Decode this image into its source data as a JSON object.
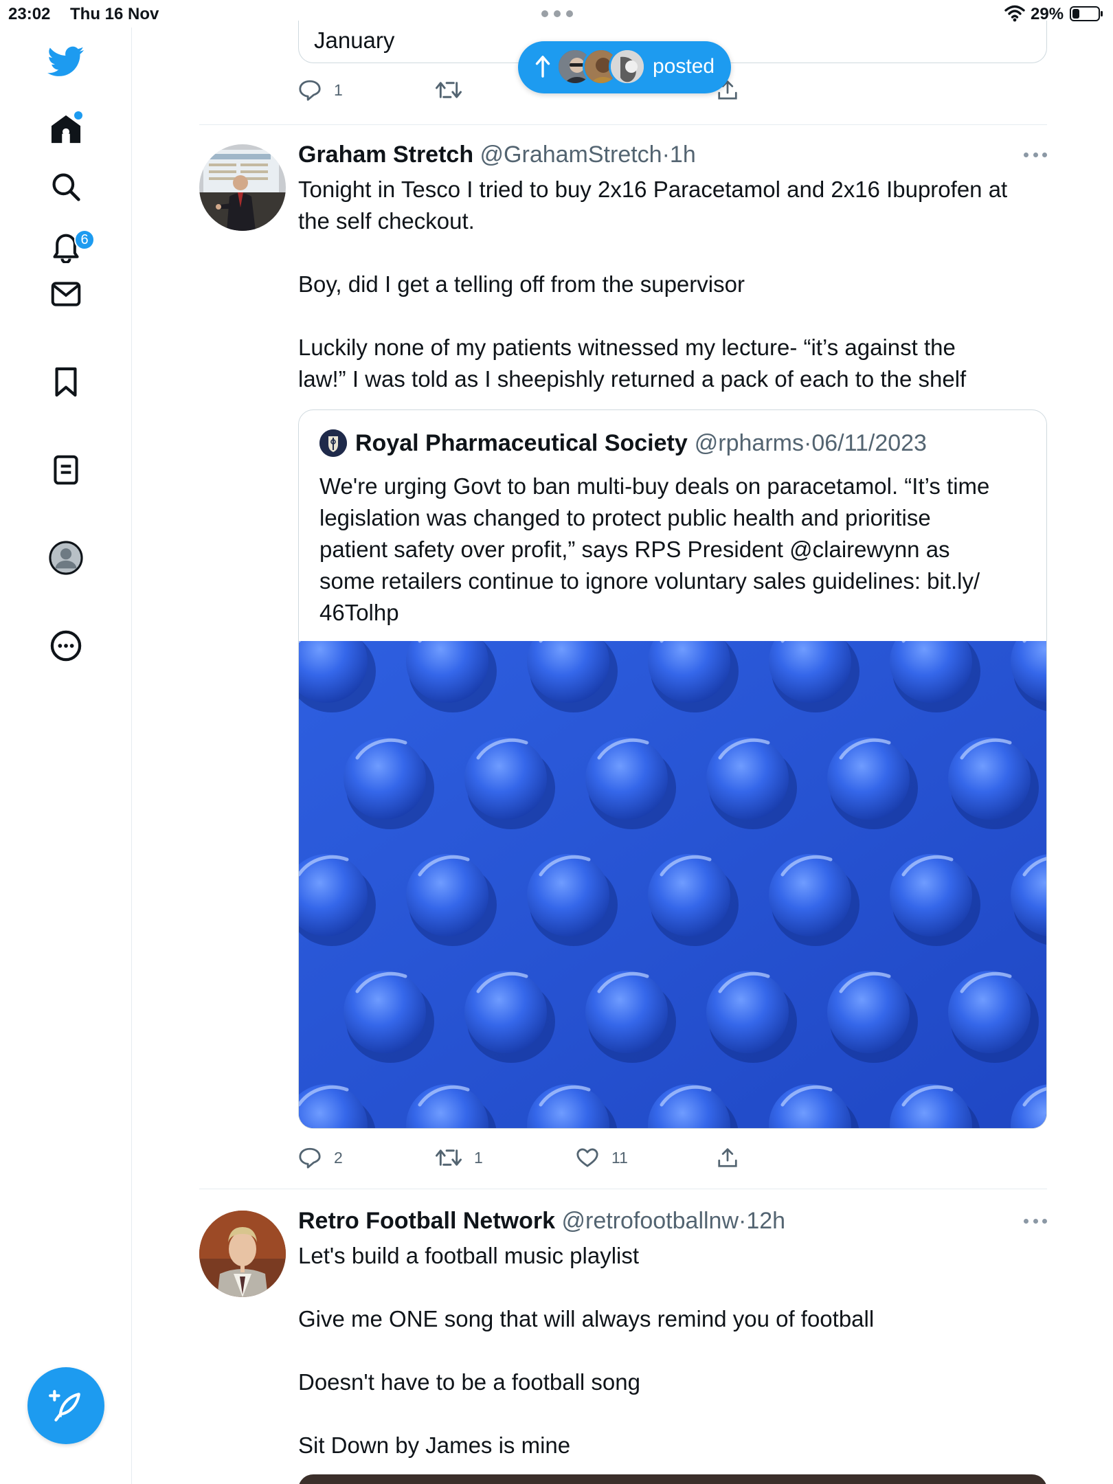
{
  "status_bar": {
    "time": "23:02",
    "date": "Thu 16 Nov",
    "battery_percent": "29%",
    "battery_level": 0.29
  },
  "sidebar": {
    "icons": [
      "twitter-bird-icon",
      "home-icon",
      "search-icon",
      "notifications-icon",
      "messages-icon",
      "bookmarks-icon",
      "lists-icon",
      "profile-icon",
      "more-icon"
    ],
    "notification_count": "6",
    "compose_icon": "compose-quill-icon"
  },
  "colors": {
    "accent": "#1d9bf0",
    "text": "#0f1419",
    "secondary_text": "#536471",
    "border": "#cfd9de"
  },
  "new_posts_pill": {
    "label": "posted"
  },
  "previous_tweet": {
    "quote_tail_text": "January",
    "replies": "1"
  },
  "tweets": [
    {
      "name": "Graham Stretch",
      "handle": "@GrahamStretch",
      "separator": "·",
      "time": "1h",
      "body": [
        "Tonight in Tesco I tried to buy 2x16 Paracetamol and 2x16 Ibuprofen at",
        "the self checkout.",
        "",
        "Boy, did I get a telling off from the supervisor",
        "",
        "Luckily none of my patients witnessed my lecture-  “it’s against the",
        "law!” I was told as I sheepishly returned a pack of each to the shelf"
      ],
      "quote": {
        "name": "Royal Pharmaceutical Society",
        "handle": "@rpharms",
        "separator": "·",
        "time": "06/11/2023",
        "body": [
          "We're urging Govt to ban multi-buy deals on paracetamol. “It’s time",
          "legislation was changed to protect public health and prioritise",
          "patient safety over profit,” says RPS President @clairewynn as",
          "some retailers continue to ignore voluntary sales guidelines: bit.ly/",
          "46Tolhp"
        ]
      },
      "replies": "2",
      "retweets": "1",
      "likes": "11"
    },
    {
      "name": "Retro Football Network",
      "handle": "@retrofootballnw",
      "separator": "·",
      "time": "12h",
      "body": [
        "Let's build a football music playlist",
        "",
        "Give me ONE song that will always remind you of football",
        "",
        "Doesn't have to be a football song",
        "",
        "Sit Down by James is mine"
      ]
    }
  ]
}
